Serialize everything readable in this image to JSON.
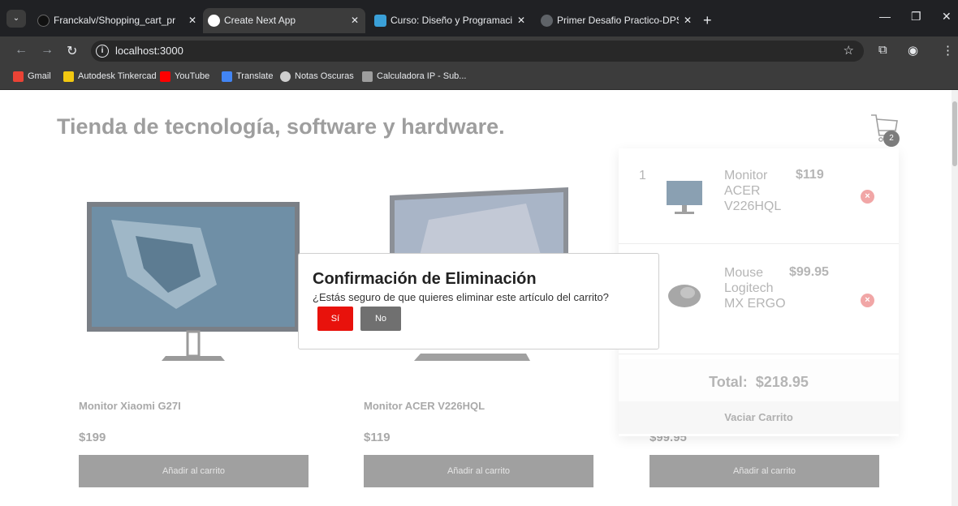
{
  "browser": {
    "tabs": [
      {
        "title": "Franckalv/Shopping_cart_projec",
        "icon": "github-icon",
        "active": false
      },
      {
        "title": "Create Next App",
        "icon": "nextjs-icon",
        "active": true
      },
      {
        "title": "Curso: Diseño y Programación",
        "icon": "course-icon",
        "active": false
      },
      {
        "title": "Primer Desafio Practico-DPS.pd",
        "icon": "pdf-icon",
        "active": false
      }
    ],
    "new_tab_label": "+",
    "url": "localhost:3000",
    "bookmarks": [
      {
        "label": "Gmail",
        "icon": "gmail-icon",
        "color": "#ea4335"
      },
      {
        "label": "Autodesk Tinkercad",
        "icon": "tinkercad-icon",
        "color": "#f2c811"
      },
      {
        "label": "YouTube",
        "icon": "youtube-icon",
        "color": "#ff0000"
      },
      {
        "label": "Translate",
        "icon": "translate-icon",
        "color": "#4285f4"
      },
      {
        "label": "Notas Oscuras",
        "icon": "notes-icon",
        "color": "#cfcfcf"
      },
      {
        "label": "Calculadora IP - Sub...",
        "icon": "calculator-icon",
        "color": "#9e9e9e"
      }
    ]
  },
  "page": {
    "title": "Tienda de tecnología, software y hardware.",
    "cart_count": "2",
    "products": [
      {
        "name": "Monitor Xiaomi G27I",
        "price": "$199",
        "button": "Añadir al carrito"
      },
      {
        "name": "Monitor ACER V226HQL",
        "price": "$119",
        "button": "Añadir al carrito"
      },
      {
        "name": "",
        "price": "$99.95",
        "button": "Añadir al carrito"
      }
    ]
  },
  "cart": {
    "items": [
      {
        "qty": "1",
        "name": "Monitor ACER V226HQL",
        "price": "$119"
      },
      {
        "qty": "",
        "name": "Mouse Logitech MX ERGO",
        "price": "$99.95"
      }
    ],
    "total_label": "Total:",
    "total_value": "$218.95",
    "empty_button": "Vaciar Carrito"
  },
  "modal": {
    "title": "Confirmación de Eliminación",
    "message": "¿Estás seguro de que quieres eliminar este artículo del carrito?",
    "yes_label": "Sí",
    "no_label": "No"
  },
  "colors": {
    "confirm": "#e8120c",
    "cancel": "#707070",
    "remove": "#f1a6a6"
  }
}
